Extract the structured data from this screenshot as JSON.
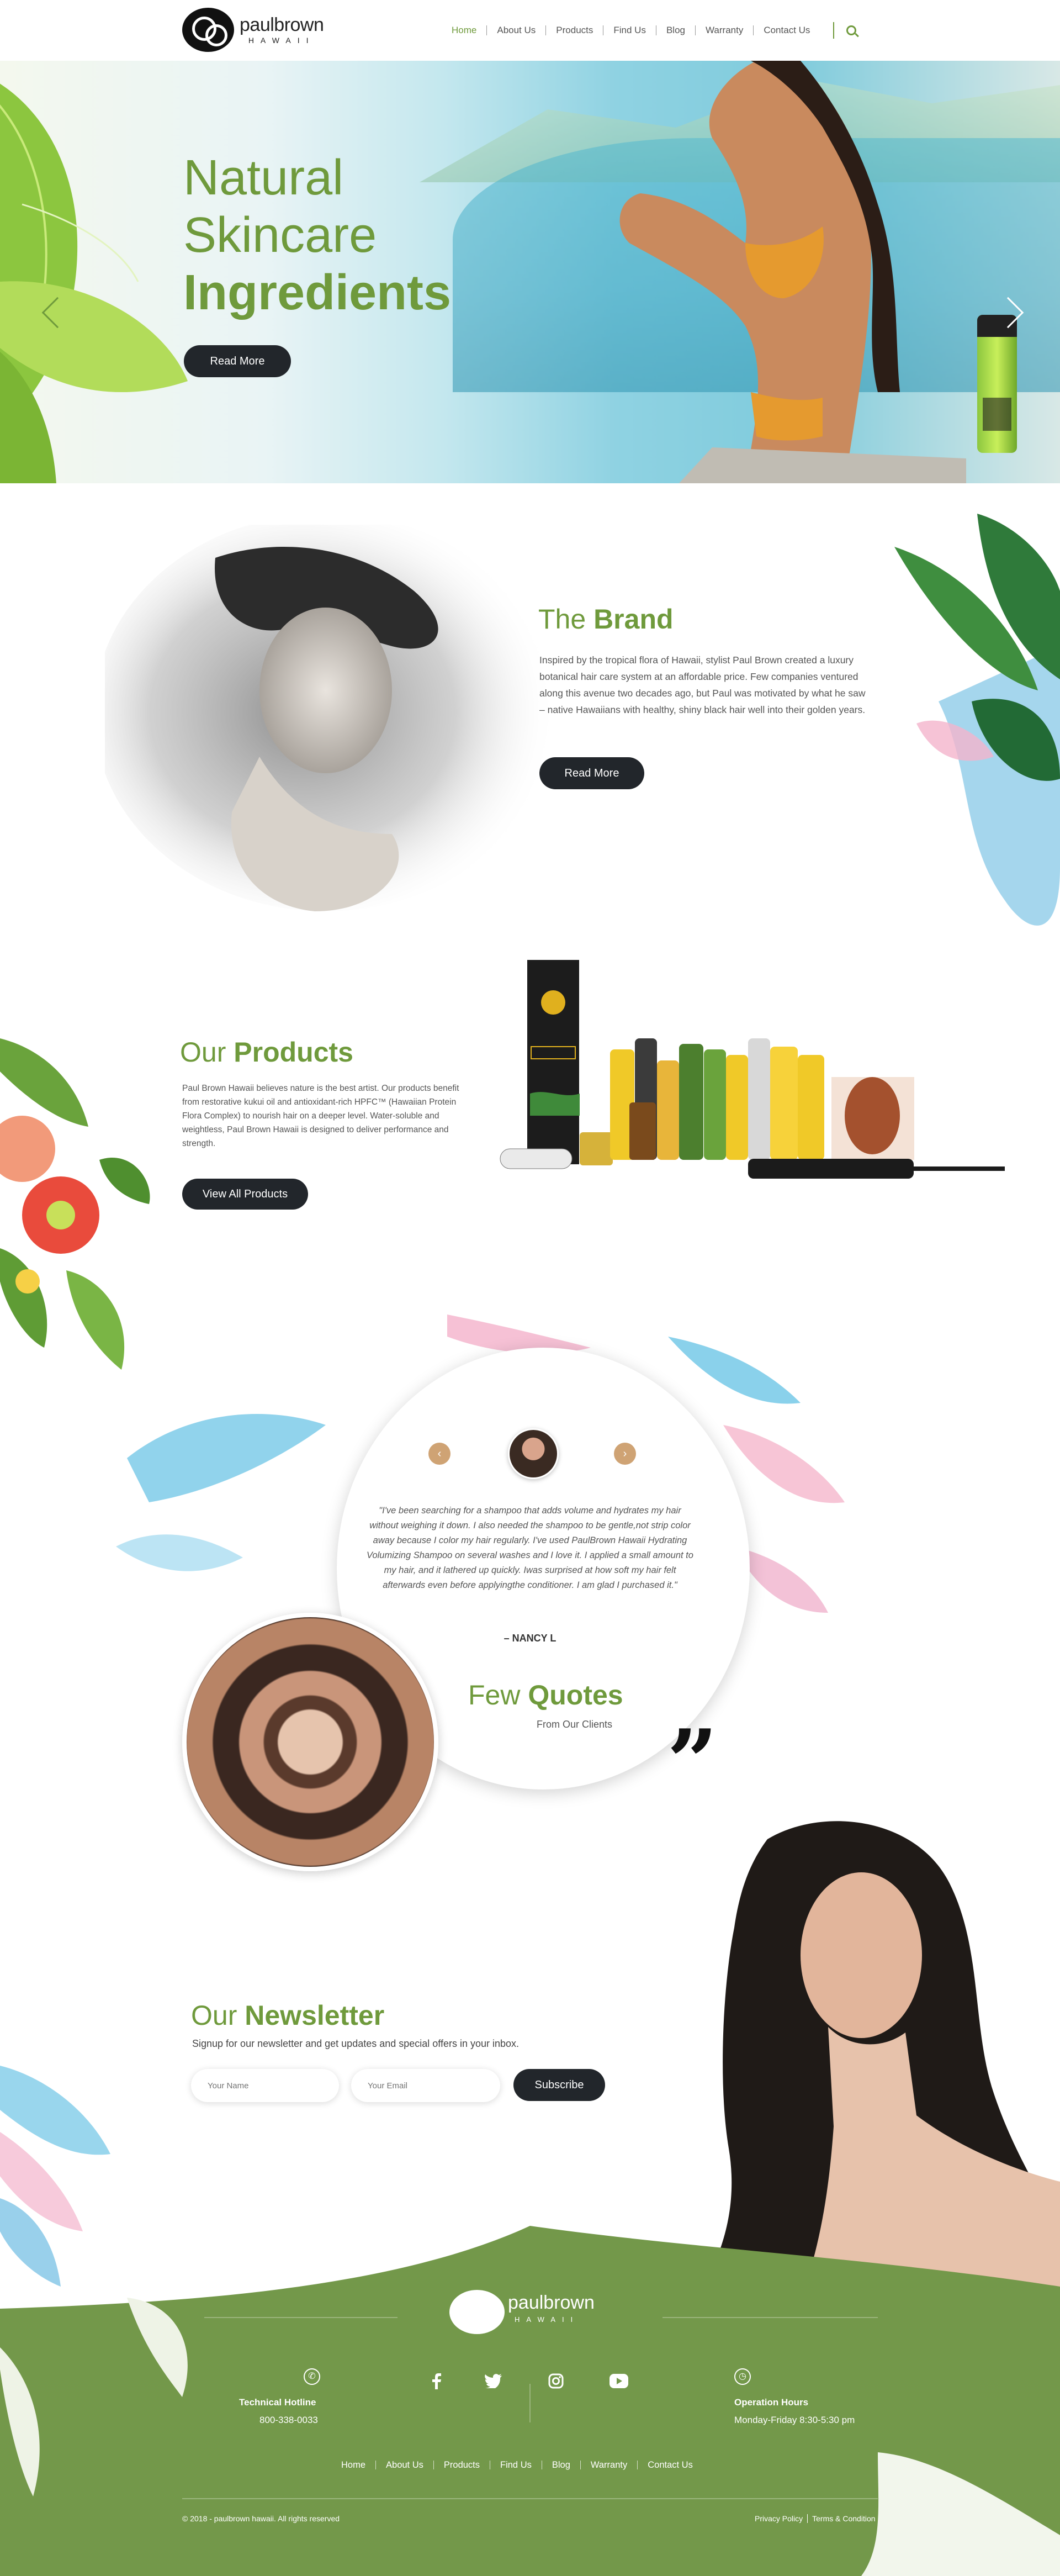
{
  "header": {
    "logo_line1": "paulbrown",
    "logo_line2": "HAWAII",
    "nav": [
      "Home",
      "About Us",
      "Products",
      "Find Us",
      "Blog",
      "Warranty",
      "Contact Us"
    ],
    "active_nav": "Home"
  },
  "hero": {
    "title_line1": "Natural",
    "title_line2": "Skincare",
    "title_line3": "Ingredients",
    "button": "Read More"
  },
  "brand": {
    "title_light": "The",
    "title_bold": "Brand",
    "text": "Inspired by the tropical flora of Hawaii, stylist Paul Brown created a luxury botanical hair care system at an affordable price. Few companies ventured along this avenue two decades ago, but Paul was motivated by what he saw – native Hawaiians with healthy, shiny black hair well into their golden years.",
    "button": "Read More"
  },
  "products": {
    "title_light": "Our",
    "title_bold": "Products",
    "text": "Paul Brown Hawaii believes nature is the best artist. Our products benefit from restorative kukui oil and antioxidant-rich HPFC™ (Hawaiian Protein Flora Complex) to nourish hair on a deeper level. Water-soluble and weightless, Paul Brown Hawaii is designed to deliver performance and strength.",
    "button": "View All Products"
  },
  "quotes": {
    "text": "\"I've been searching for a shampoo that adds volume and hydrates my hair without weighing it down. I also needed the shampoo to be gentle,not strip color away because I color my hair regularly. I've used PaulBrown Hawaii Hydrating Volumizing Shampoo on several washes and I love it. I applied a small amount to my hair, and it lathered up quickly. Iwas surprised at how soft my hair felt afterwards even before applyingthe conditioner. I am glad I purchased it.\"",
    "author": "– NANCY L",
    "title_light": "Few",
    "title_bold": "Quotes",
    "subtitle": "From Our Clients",
    "prev": "‹",
    "next": "›",
    "mark": "”"
  },
  "newsletter": {
    "title_light": "Our",
    "title_bold": "Newsletter",
    "subtitle": "Signup for our newsletter and get updates and special offers in your inbox.",
    "name_placeholder": "Your Name",
    "email_placeholder": "Your Email",
    "button": "Subscribe"
  },
  "footer": {
    "logo_line1": "paulbrown",
    "logo_line2": "HAWAII",
    "hotline_label": "Technical Hotline",
    "hotline_value": "800-338-0033",
    "hours_label": "Operation Hours",
    "hours_value": "Monday-Friday 8:30-5:30 pm",
    "social": [
      "facebook-icon",
      "twitter-icon",
      "instagram-icon",
      "youtube-icon"
    ],
    "links": [
      "Home",
      "About Us",
      "Products",
      "Find Us",
      "Blog",
      "Warranty",
      "Contact Us"
    ],
    "copyright": "© 2018 - paulbrown hawaii. All rights reserved",
    "policy": "Privacy Policy",
    "terms": "Terms & Condition"
  },
  "colors": {
    "accent_green": "#6f9a3c",
    "dark_button": "#22262b",
    "footer_green": "#73984a",
    "quote_nav": "#cfa374"
  }
}
